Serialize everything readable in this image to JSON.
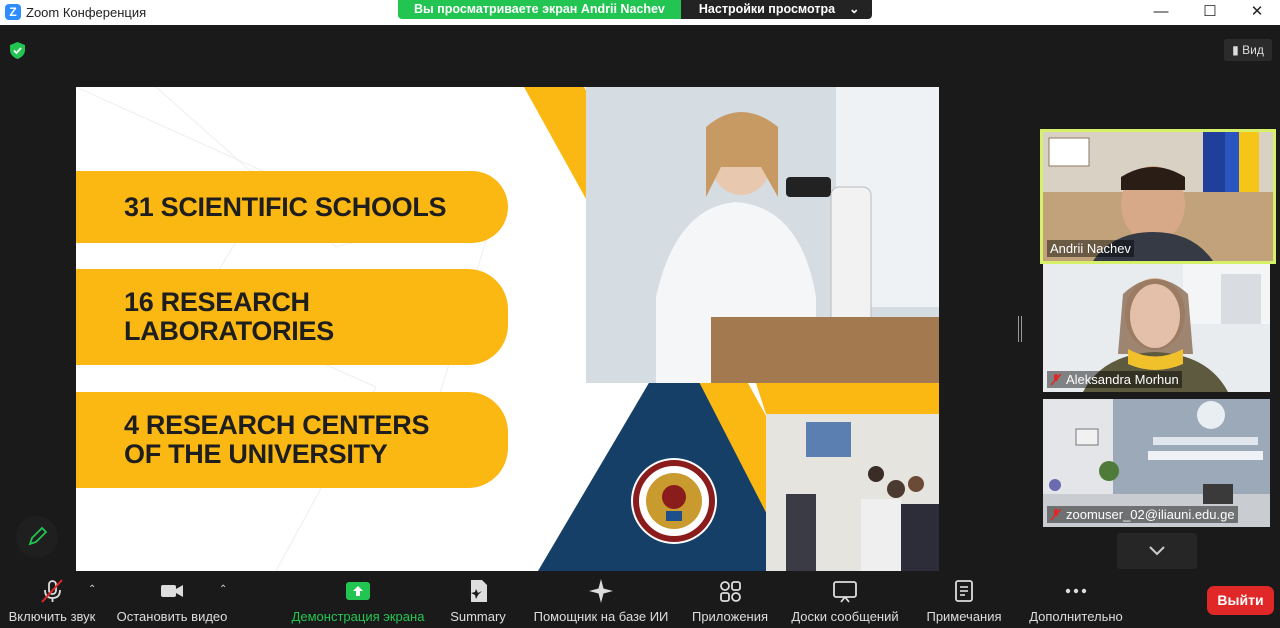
{
  "window": {
    "title": "Zoom Конференция",
    "logo_letter": "Z"
  },
  "share_banner": {
    "viewing_text": "Вы просматриваете экран Andrii Nachev",
    "settings_label": "Настройки просмотра"
  },
  "view_button": {
    "label": "Вид"
  },
  "slide": {
    "items": [
      {
        "text": "31 SCIENTIFIC SCHOOLS"
      },
      {
        "text": "16 RESEARCH LABORATORIES"
      },
      {
        "text": "4 RESEARCH CENTERS OF THE UNIVERSITY"
      }
    ],
    "colors": {
      "accent": "#fbb813",
      "navy": "#153f66"
    }
  },
  "participants": [
    {
      "name": "Andrii Nachev",
      "muted": false,
      "speaking": true
    },
    {
      "name": "Aleksandra Morhun",
      "muted": true,
      "speaking": false
    },
    {
      "name": "zoomuser_02@iliauni.edu.ge",
      "muted": true,
      "speaking": false
    }
  ],
  "toolbar": {
    "unmute": "Включить звук",
    "stop_video": "Остановить видео",
    "share_screen": "Демонстрация экрана",
    "summary": "Summary",
    "ai_assistant": "Помощник на базе ИИ",
    "apps": "Приложения",
    "whiteboards": "Доски сообщений",
    "notes": "Примечания",
    "more": "Дополнительно",
    "leave": "Выйти"
  }
}
